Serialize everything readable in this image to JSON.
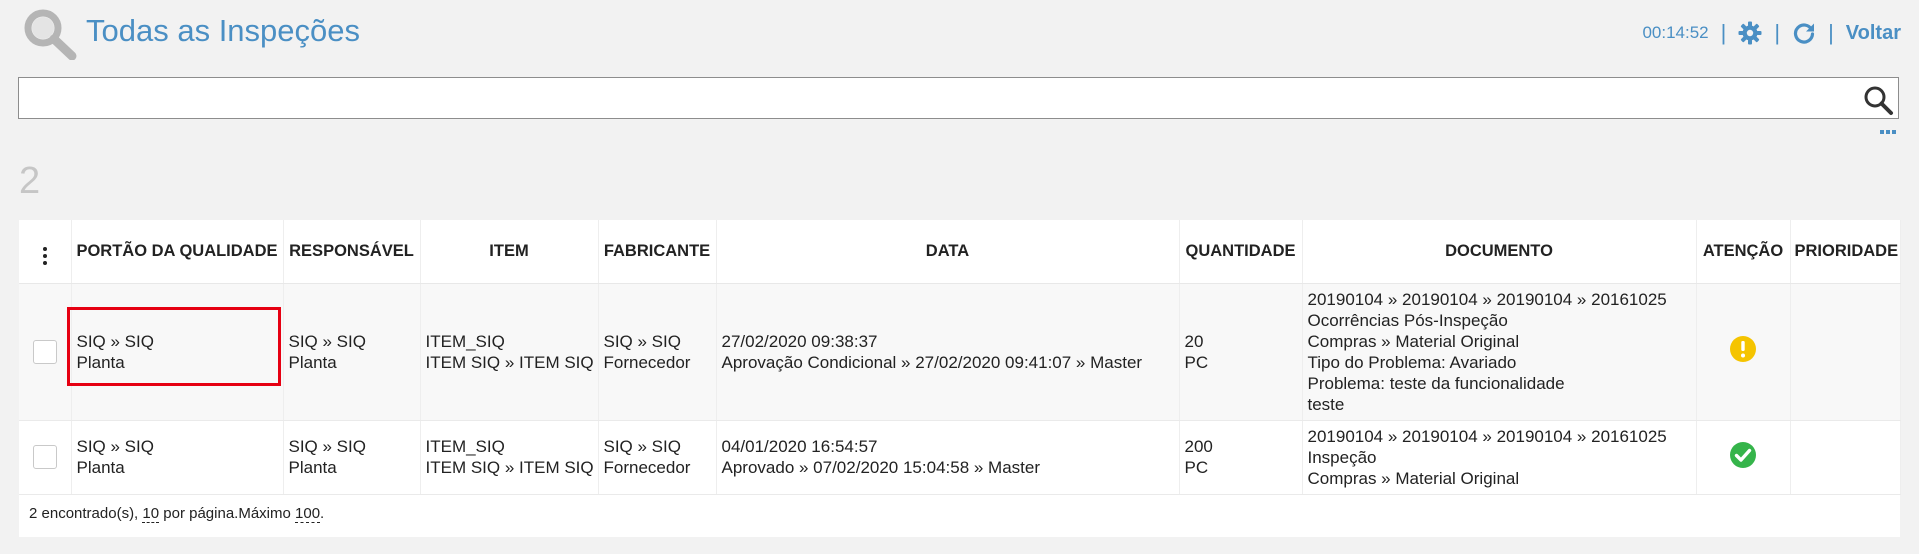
{
  "header": {
    "title": "Todas as Inspeções",
    "clock": "00:14:52",
    "back_label": "Voltar",
    "icons": {
      "logo": "magnifier-icon",
      "settings": "gear-icon",
      "refresh": "refresh-icon"
    }
  },
  "search": {
    "value": "",
    "placeholder": ""
  },
  "count": "2",
  "table": {
    "headers": [
      "PORTÃO DA QUALIDADE",
      "RESPONSÁVEL",
      "ITEM",
      "FABRICANTE",
      "DATA",
      "QUANTIDADE",
      "DOCUMENTO",
      "ATENÇÃO",
      "PRIORIDADE"
    ],
    "rows": [
      {
        "portao": [
          "SIQ » SIQ",
          "Planta"
        ],
        "responsavel": [
          "SIQ » SIQ",
          "Planta"
        ],
        "item": [
          "ITEM_SIQ",
          "ITEM SIQ » ITEM SIQ"
        ],
        "fabricante": [
          "SIQ » SIQ",
          "Fornecedor"
        ],
        "data": [
          "27/02/2020 09:38:37",
          "Aprovação Condicional » 27/02/2020 09:41:07 » Master"
        ],
        "quantidade": [
          "20",
          "PC"
        ],
        "documento": [
          "20190104 » 20190104 » 20190104 » 20161025",
          "Ocorrências Pós-Inspeção",
          "Compras » Material Original",
          "Tipo do Problema: Avariado",
          "Problema: teste da funcionalidade",
          "teste"
        ],
        "atencao": "warning-icon",
        "prioridade": ""
      },
      {
        "portao": [
          "SIQ » SIQ",
          "Planta"
        ],
        "responsavel": [
          "SIQ » SIQ",
          "Planta"
        ],
        "item": [
          "ITEM_SIQ",
          "ITEM SIQ » ITEM SIQ"
        ],
        "fabricante": [
          "SIQ » SIQ",
          "Fornecedor"
        ],
        "data": [
          "04/01/2020 16:54:57",
          "Aprovado » 07/02/2020 15:04:58 » Master"
        ],
        "quantidade": [
          "200",
          "PC"
        ],
        "documento": [
          "20190104 » 20190104 » 20190104 » 20161025",
          "Inspeção",
          "Compras » Material Original"
        ],
        "atencao": "check-circle-icon",
        "prioridade": ""
      }
    ]
  },
  "footer": {
    "found": "2 encontrado(s),",
    "per_page_value": "10",
    "per_page_text": "por página.Máximo",
    "max_value": "100",
    "end": "."
  },
  "colors": {
    "accent": "#4a8fc4",
    "warning": "#f5c400",
    "success": "#35b44a",
    "highlight": "#e60012"
  }
}
